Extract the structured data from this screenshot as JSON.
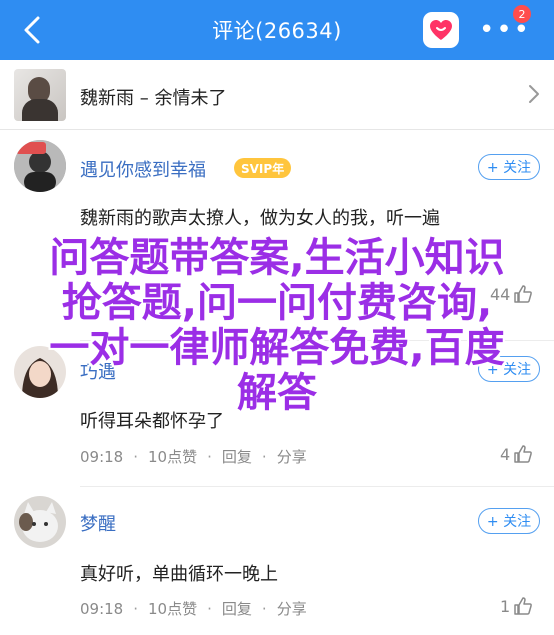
{
  "header": {
    "title": "评论(26634)",
    "badge_count": "2",
    "accent_color": "#2f8df2",
    "icons": [
      "chevron-left-icon",
      "heart-icon",
      "more-icon"
    ]
  },
  "song": {
    "title": "魏新雨 – 余情未了",
    "icon": "chevron-right-icon"
  },
  "comments": [
    {
      "username": "遇见你感到幸福",
      "vip_badge": "SVIP年",
      "follow_label": "+ 关注",
      "text": "魏新雨的歌声太撩人，做为女人的我，听一遍",
      "meta": {
        "time": "",
        "likes": "",
        "reply": "",
        "share": ""
      },
      "like_count": "44"
    },
    {
      "username": "巧遇",
      "follow_label": "+ 关注",
      "text": "听得耳朵都怀孕了",
      "meta": {
        "time": "09:18",
        "likes": "10点赞",
        "reply": "回复",
        "share": "分享"
      },
      "like_count": "4"
    },
    {
      "username": "梦醒",
      "follow_label": "+ 关注",
      "text": "真好听，单曲循环一晚上",
      "meta": {
        "time": "09:18",
        "likes": "10点赞",
        "reply": "回复",
        "share": "分享"
      },
      "like_count": "1"
    }
  ],
  "watermark": {
    "line1": "问答题带答案,生活小知识",
    "line2": "抢答题,问一问付费咨询,",
    "line3": "一对一律师解答免费,百度",
    "line4": "解答",
    "color": "#9b2ee6"
  }
}
